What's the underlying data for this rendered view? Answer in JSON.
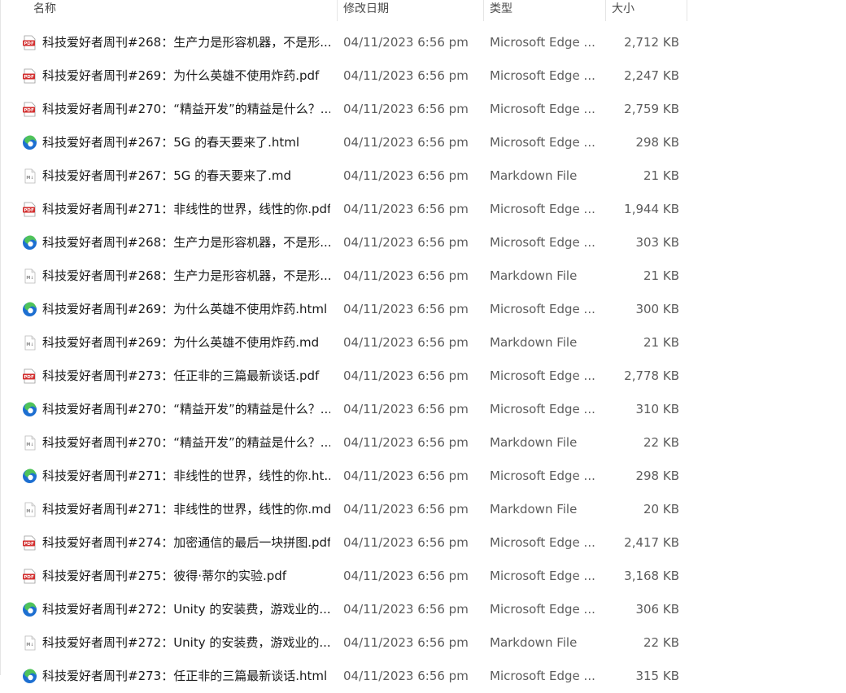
{
  "columns": {
    "name": "名称",
    "date": "修改日期",
    "type": "类型",
    "size": "大小"
  },
  "files": [
    {
      "name": "科技爱好者周刊#268：生产力是形容机器，不是形...",
      "date": "04/11/2023 6:56 pm",
      "type": "Microsoft Edge ...",
      "size": "2,712 KB",
      "icon": "pdf-icon"
    },
    {
      "name": "科技爱好者周刊#269：为什么英雄不使用炸药.pdf",
      "date": "04/11/2023 6:56 pm",
      "type": "Microsoft Edge ...",
      "size": "2,247 KB",
      "icon": "pdf-icon"
    },
    {
      "name": "科技爱好者周刊#270：“精益开发”的精益是什么？....",
      "date": "04/11/2023 6:56 pm",
      "type": "Microsoft Edge ...",
      "size": "2,759 KB",
      "icon": "pdf-icon"
    },
    {
      "name": "科技爱好者周刊#267：5G 的春天要来了.html",
      "date": "04/11/2023 6:56 pm",
      "type": "Microsoft Edge ...",
      "size": "298 KB",
      "icon": "edge-icon"
    },
    {
      "name": "科技爱好者周刊#267：5G 的春天要来了.md",
      "date": "04/11/2023 6:56 pm",
      "type": "Markdown File",
      "size": "21 KB",
      "icon": "markdown-icon"
    },
    {
      "name": "科技爱好者周刊#271：非线性的世界，线性的你.pdf",
      "date": "04/11/2023 6:56 pm",
      "type": "Microsoft Edge ...",
      "size": "1,944 KB",
      "icon": "pdf-icon"
    },
    {
      "name": "科技爱好者周刊#268：生产力是形容机器，不是形...",
      "date": "04/11/2023 6:56 pm",
      "type": "Microsoft Edge ...",
      "size": "303 KB",
      "icon": "edge-icon"
    },
    {
      "name": "科技爱好者周刊#268：生产力是形容机器，不是形...",
      "date": "04/11/2023 6:56 pm",
      "type": "Markdown File",
      "size": "21 KB",
      "icon": "markdown-icon"
    },
    {
      "name": "科技爱好者周刊#269：为什么英雄不使用炸药.html",
      "date": "04/11/2023 6:56 pm",
      "type": "Microsoft Edge ...",
      "size": "300 KB",
      "icon": "edge-icon"
    },
    {
      "name": "科技爱好者周刊#269：为什么英雄不使用炸药.md",
      "date": "04/11/2023 6:56 pm",
      "type": "Markdown File",
      "size": "21 KB",
      "icon": "markdown-icon"
    },
    {
      "name": "科技爱好者周刊#273：任正非的三篇最新谈话.pdf",
      "date": "04/11/2023 6:56 pm",
      "type": "Microsoft Edge ...",
      "size": "2,778 KB",
      "icon": "pdf-icon"
    },
    {
      "name": "科技爱好者周刊#270：“精益开发”的精益是什么？....",
      "date": "04/11/2023 6:56 pm",
      "type": "Microsoft Edge ...",
      "size": "310 KB",
      "icon": "edge-icon"
    },
    {
      "name": "科技爱好者周刊#270：“精益开发”的精益是什么？....",
      "date": "04/11/2023 6:56 pm",
      "type": "Markdown File",
      "size": "22 KB",
      "icon": "markdown-icon"
    },
    {
      "name": "科技爱好者周刊#271：非线性的世界，线性的你.ht...",
      "date": "04/11/2023 6:56 pm",
      "type": "Microsoft Edge ...",
      "size": "298 KB",
      "icon": "edge-icon"
    },
    {
      "name": "科技爱好者周刊#271：非线性的世界，线性的你.md",
      "date": "04/11/2023 6:56 pm",
      "type": "Markdown File",
      "size": "20 KB",
      "icon": "markdown-icon"
    },
    {
      "name": "科技爱好者周刊#274：加密通信的最后一块拼图.pdf",
      "date": "04/11/2023 6:56 pm",
      "type": "Microsoft Edge ...",
      "size": "2,417 KB",
      "icon": "pdf-icon"
    },
    {
      "name": "科技爱好者周刊#275：彼得·蒂尔的实验.pdf",
      "date": "04/11/2023 6:56 pm",
      "type": "Microsoft Edge ...",
      "size": "3,168 KB",
      "icon": "pdf-icon"
    },
    {
      "name": "科技爱好者周刊#272：Unity 的安装费，游戏业的...",
      "date": "04/11/2023 6:56 pm",
      "type": "Microsoft Edge ...",
      "size": "306 KB",
      "icon": "edge-icon"
    },
    {
      "name": "科技爱好者周刊#272：Unity 的安装费，游戏业的...",
      "date": "04/11/2023 6:56 pm",
      "type": "Markdown File",
      "size": "22 KB",
      "icon": "markdown-icon"
    },
    {
      "name": "科技爱好者周刊#273：任正非的三篇最新谈话.html",
      "date": "04/11/2023 6:56 pm",
      "type": "Microsoft Edge ...",
      "size": "315 KB",
      "icon": "edge-icon"
    }
  ],
  "colors": {
    "pdf": "#d32f2f",
    "edge_blue": "#1d6fd1",
    "edge_green": "#4fc35a",
    "md": "#e3e3e3"
  }
}
